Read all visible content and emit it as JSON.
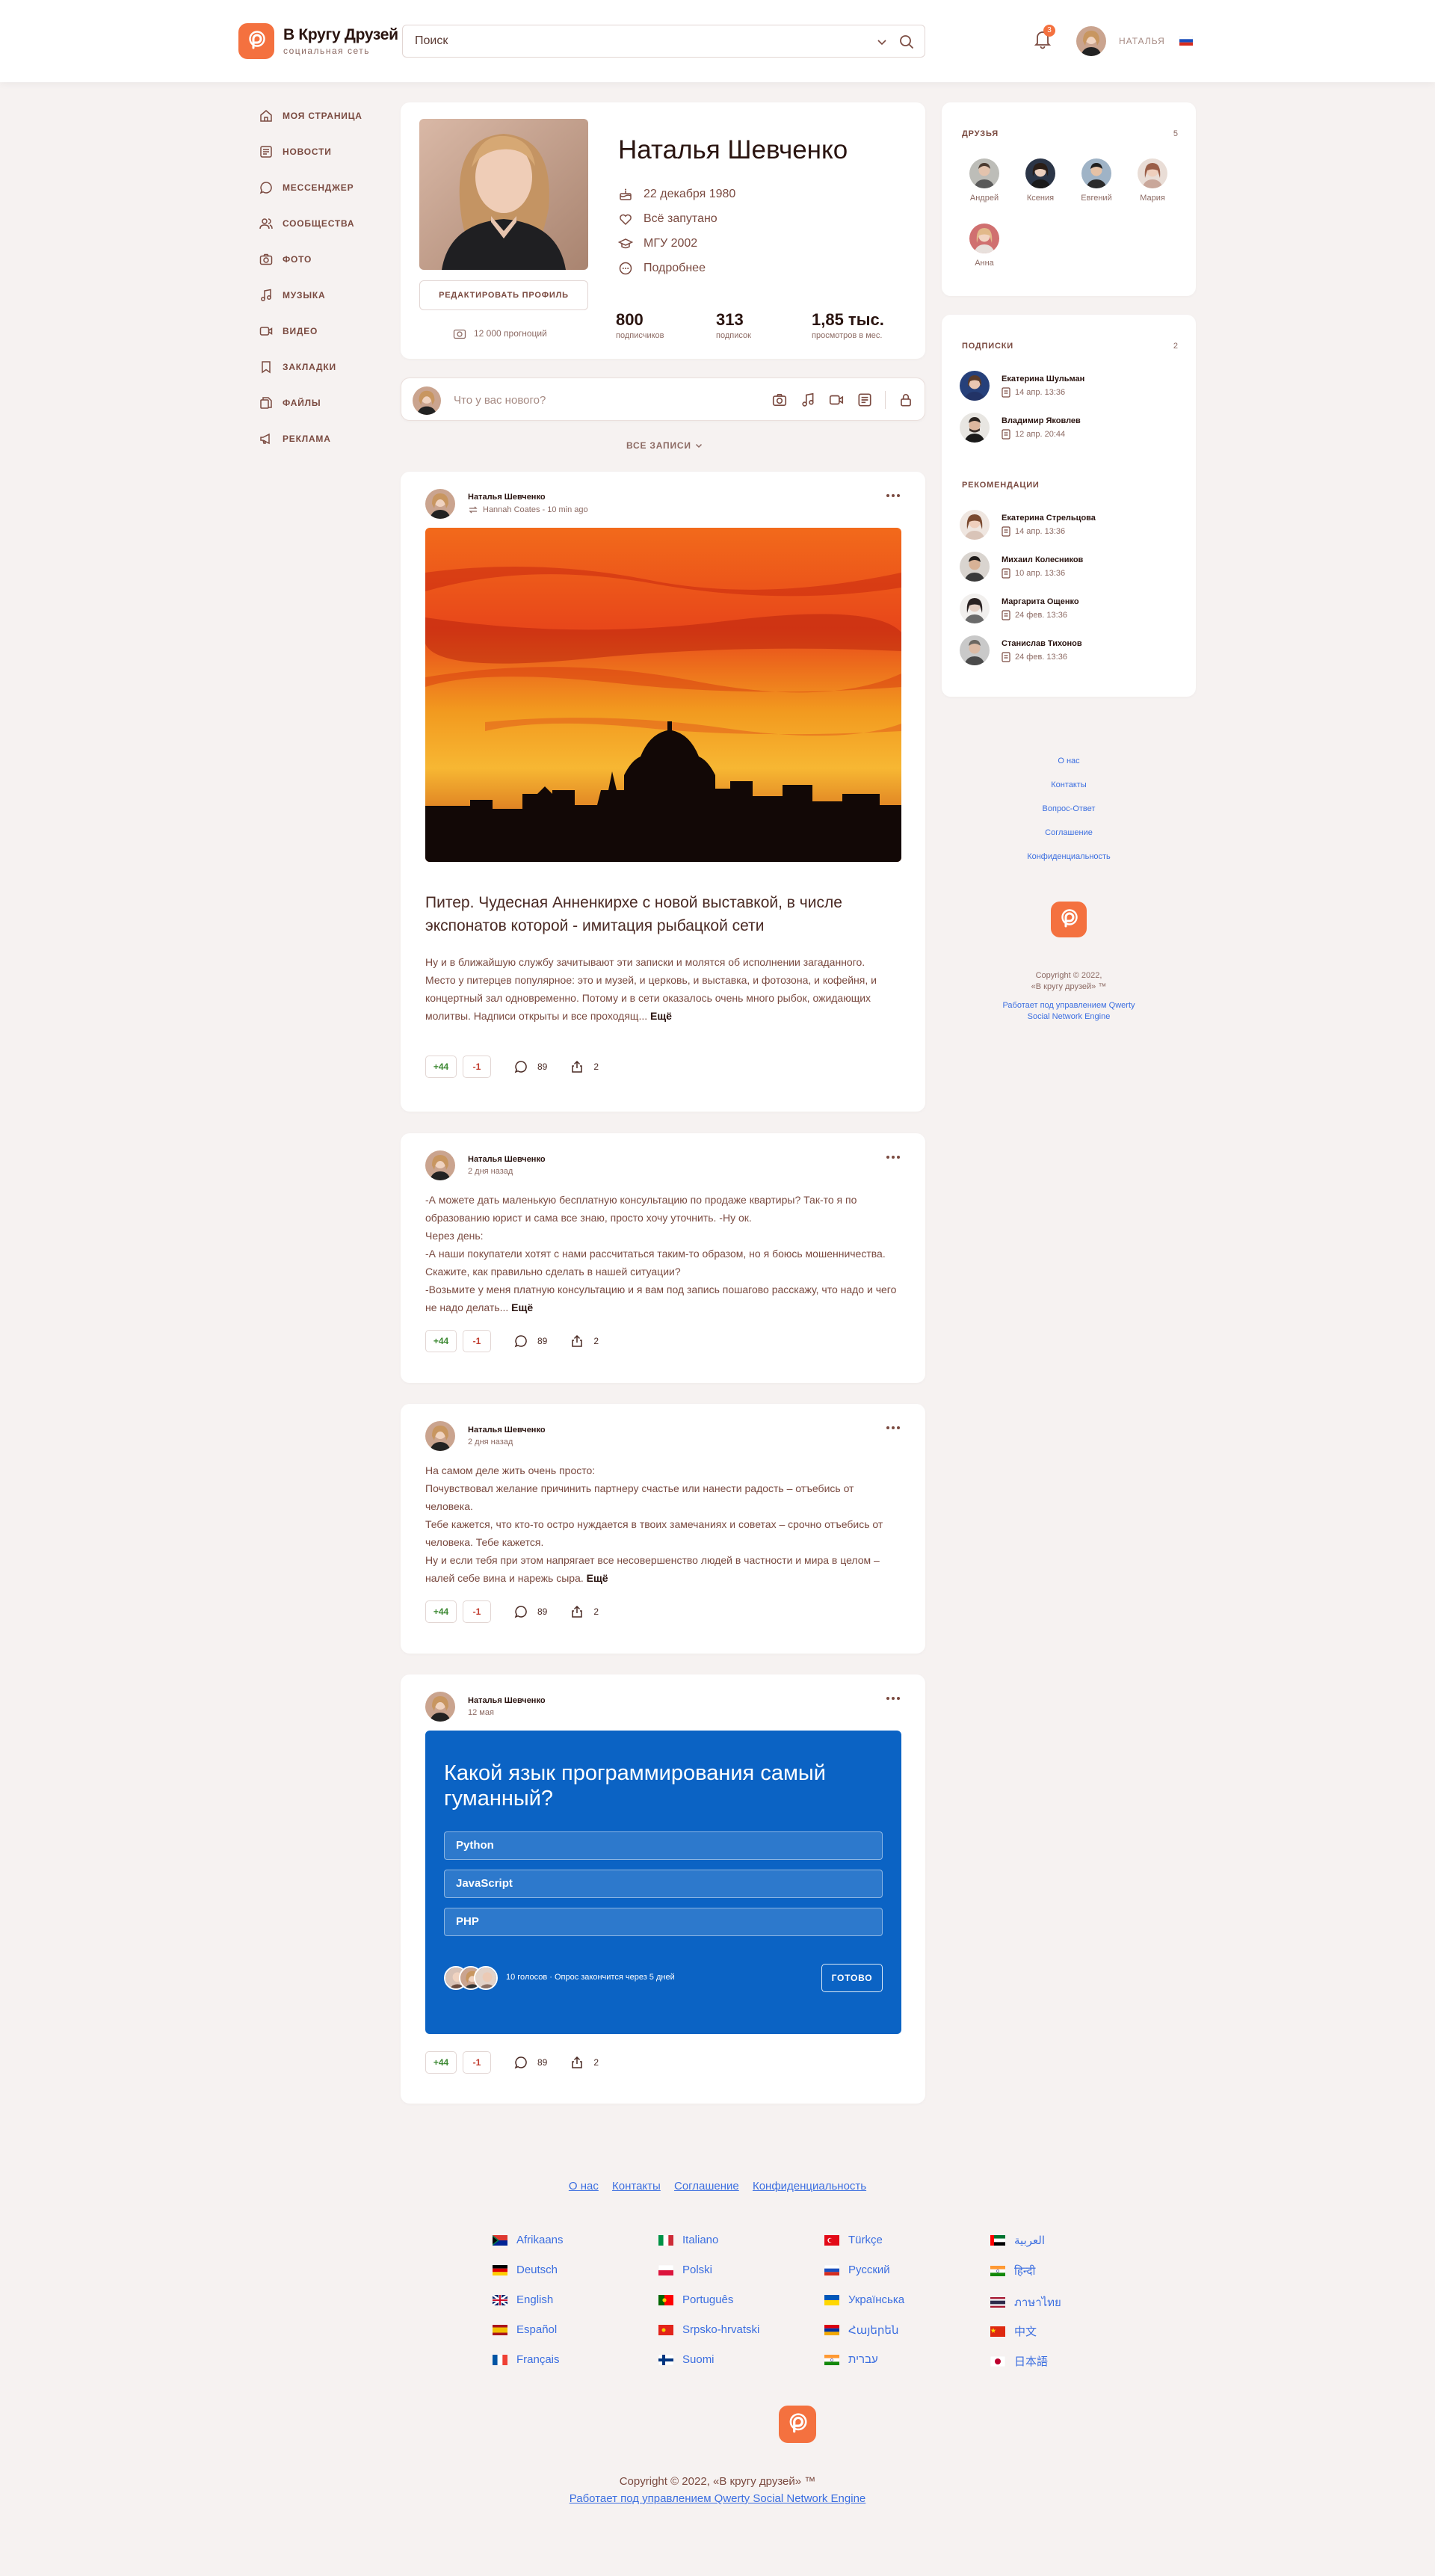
{
  "header": {
    "brand_title": "В Кругу Друзей",
    "brand_subtitle": "социальная сеть",
    "search_placeholder": "Поиск",
    "notifications_count": "3",
    "user_name": "НАТАЛЬЯ"
  },
  "sidebar": {
    "items": [
      {
        "label": "МОЯ СТРАНИЦА",
        "icon": "home-icon"
      },
      {
        "label": "НОВОСТИ",
        "icon": "news-icon"
      },
      {
        "label": "МЕССЕНДЖЕР",
        "icon": "messenger-icon"
      },
      {
        "label": "СООБЩЕСТВА",
        "icon": "communities-icon"
      },
      {
        "label": "ФОТО",
        "icon": "camera-icon"
      },
      {
        "label": "МУЗЫКА",
        "icon": "music-icon"
      },
      {
        "label": "ВИДЕО",
        "icon": "video-icon"
      },
      {
        "label": "ЗАКЛАДКИ",
        "icon": "bookmark-icon"
      },
      {
        "label": "ФАЙЛЫ",
        "icon": "files-icon"
      },
      {
        "label": "РЕКЛАМА",
        "icon": "megaphone-icon"
      }
    ]
  },
  "profile": {
    "name": "Наталья Шевченко",
    "birthday": "22 декабря 1980",
    "relationship": "Всё запутано",
    "education": "МГУ 2002",
    "more": "Подробнее",
    "edit_label": "РЕДАКТИРОВАТЬ ПРОФИЛЬ",
    "photos_count": "12 000 прогноций",
    "stats": [
      {
        "value": "800",
        "label": "подписчиков"
      },
      {
        "value": "313",
        "label": "подписок"
      },
      {
        "value": "1,85 тыс.",
        "label": "просмотров в мес."
      }
    ]
  },
  "composer": {
    "placeholder": "Что у вас нового?"
  },
  "feed_filter": "ВСЕ ЗАПИСИ",
  "posts": [
    {
      "author": "Наталья Шевченко",
      "sub": "Hannah Coates - 10 min ago",
      "title": "Питер. Чудесная Анненкирхе с новой выставкой, в числе экспонатов которой - имитация рыбацкой сети",
      "text": "Ну и в ближайшую службу зачитывают эти записки и молятся об исполнении загаданного.\nМесто у питерцев популярное: это и музей, и церковь, и выставка, и фотозона, и кофейня, и концертный зал одновременно. Потому и в сети оказалось очень много рыбок, ожидающих молитвы. Надписи открыты и все проходящ... ",
      "more": "Ещё",
      "plus": "+44",
      "minus": "-1",
      "comments": "89",
      "shares": "2"
    },
    {
      "author": "Наталья Шевченко",
      "sub": "2 дня назад",
      "text": "-А можете дать маленькую бесплатную консультацию по продаже квартиры? Так-то я по образованию юрист и сама все знаю, просто хочу уточнить. -Ну ок.\nЧерез день:\n-А наши покупатели хотят с нами рассчитаться таким-то образом, но я боюсь мошенничества. Скажите, как правильно сделать в нашей ситуации?\n-Возьмите у меня платную консультацию и я вам под запись пошагово расскажу, что надо и чего не надо делать... ",
      "more": "Ещё",
      "plus": "+44",
      "minus": "-1",
      "comments": "89",
      "shares": "2"
    },
    {
      "author": "Наталья Шевченко",
      "sub": "2 дня назад",
      "text": "На самом деле жить очень просто:\nПочувствовал желание причинить партнеру счастье или нанести радость – отъебись от человека.\nТебе кажется, что кто-то остро нуждается в твоих замечаниях и советах – срочно отъебись от человека. Тебе кажется.\nНу и если тебя при этом напрягает все несовершенство людей в частности и мира в целом – налей себе вина и нарежь сыра. ",
      "more": "Ещё",
      "plus": "+44",
      "minus": "-1",
      "comments": "89",
      "shares": "2"
    },
    {
      "author": "Наталья Шевченко",
      "sub": "12 мая",
      "poll": {
        "question": "Какой язык программирования самый гуманный?",
        "options": [
          "Python",
          "JavaScript",
          "PHP"
        ],
        "info": "10 голосов · Опрос закончится через 5 дней",
        "button": "ГОТОВО",
        "accent": "#0b63c4"
      },
      "plus": "+44",
      "minus": "-1",
      "comments": "89",
      "shares": "2"
    }
  ],
  "friends": {
    "title": "ДРУЗЬЯ",
    "count": "5",
    "items": [
      "Андрей",
      "Ксения",
      "Евгений",
      "Мария",
      "Анна"
    ]
  },
  "subscriptions": {
    "title": "ПОДПИСКИ",
    "count": "2",
    "items": [
      {
        "name": "Екатерина Шульман",
        "date": "14 апр. 13:36"
      },
      {
        "name": "Владимир Яковлев",
        "date": "12 апр. 20:44"
      }
    ]
  },
  "recommendations": {
    "title": "РЕКОМЕНДАЦИИ",
    "items": [
      {
        "name": "Екатерина Стрельцова",
        "date": "14 апр. 13:36"
      },
      {
        "name": "Михаил Колесников",
        "date": "10 апр. 13:36"
      },
      {
        "name": "Маргарита Ощенко",
        "date": "24 фев. 13:36"
      },
      {
        "name": "Станислав Тихонов",
        "date": "24 фев. 13:36"
      }
    ]
  },
  "right_links": [
    "О нас",
    "Контакты",
    "Вопрос-Ответ",
    "Соглашение",
    "Конфиденциальность"
  ],
  "right_copyright": "Copyright © 2022,\n«В кругу друзей» ™",
  "right_powered": "Работает под управлением Qwerty Social Network Engine",
  "footer": {
    "links": [
      "О нас",
      "Контакты",
      "Соглашение",
      "Конфиденциальность"
    ],
    "languages": [
      [
        "Afrikaans",
        "Deutsch",
        "English",
        "Español",
        "Français"
      ],
      [
        "Italiano",
        "Polski",
        "Português",
        "Srpsko-hrvatski",
        "Suomi"
      ],
      [
        "Türkçe",
        "Русский",
        "Українська",
        "Հայերեն",
        "עברית"
      ],
      [
        "العربية",
        "हिन्दी",
        "ภาษาไทย",
        "中文",
        "日本語"
      ]
    ],
    "copyright": "Copyright © 2022, «В кругу друзей» ™",
    "powered": "Работает под управлением Qwerty Social Network Engine"
  },
  "colors": {
    "accent": "#f4713f",
    "link": "#3b6ee0",
    "poll": "#0b63c4",
    "background": "#f6f2f1"
  }
}
